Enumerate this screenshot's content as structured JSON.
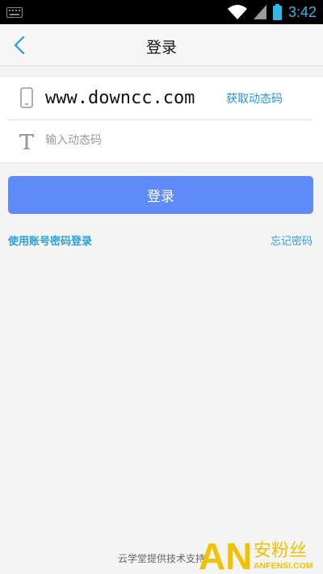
{
  "status_bar": {
    "time": "3:42"
  },
  "nav": {
    "title": "登录"
  },
  "form": {
    "phone_value": "www.downcc.com",
    "get_code_label": "获取动态码",
    "code_placeholder": "输入动态码"
  },
  "actions": {
    "login_label": "登录",
    "account_login_label": "使用账号密码登录",
    "forgot_password_label": "忘记密码"
  },
  "footer": {
    "text": "云学堂提供技术支持"
  },
  "watermark": {
    "logo_text": "AN",
    "brand_text": "安粉丝",
    "site_text": "ANFENSI.COM"
  },
  "colors": {
    "accent": "#2196f3",
    "button": "#5f8bf8",
    "link": "#2aa0d9",
    "time": "#33b5e5"
  }
}
